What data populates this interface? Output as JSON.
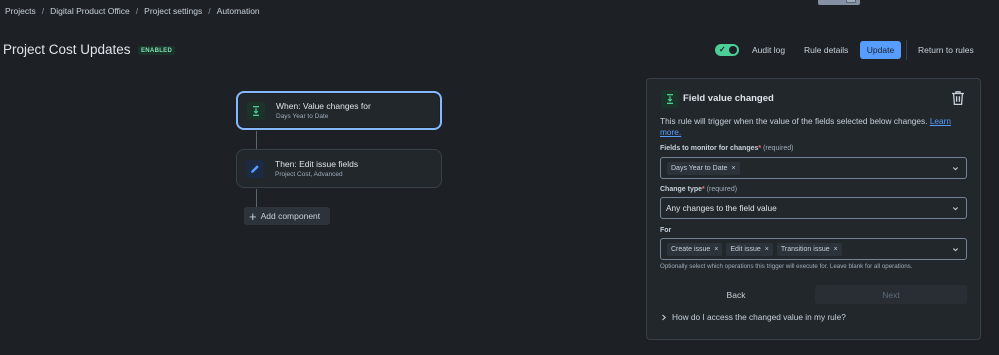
{
  "breadcrumb": {
    "items": [
      "Projects",
      "Digital Product Office",
      "Project settings",
      "Automation"
    ],
    "separator": "/"
  },
  "header": {
    "title": "Project Cost Updates",
    "badge": "ENABLED",
    "toggle_on": true,
    "audit_log": "Audit log",
    "rule_details": "Rule details",
    "update": "Update",
    "return": "Return to rules"
  },
  "flow": {
    "trigger": {
      "title": "When: Value changes for",
      "subtitle": "Days Year to Date",
      "icon": "field-value-icon"
    },
    "action": {
      "title": "Then: Edit issue fields",
      "subtitle": "Project Cost, Advanced",
      "icon": "pencil-icon"
    },
    "add_component": "Add component"
  },
  "panel": {
    "title": "Field value changed",
    "description": "This rule will trigger when the value of the fields selected below changes.",
    "learn_more": "Learn more.",
    "fields_label": "Fields to monitor for changes",
    "required_marker": "*",
    "required_text": "(required)",
    "fields_chips": [
      "Days Year to Date"
    ],
    "change_type_label": "Change type",
    "change_type_value": "Any changes to the field value",
    "for_label": "For",
    "for_chips": [
      "Create issue",
      "Edit issue",
      "Transition issue"
    ],
    "helper": "Optionally select which operations this trigger will execute for. Leave blank for all operations.",
    "back": "Back",
    "next": "Next",
    "faq": "How do I access the changed value in my rule?"
  },
  "colors": {
    "background": "#1d2125",
    "accent": "#579dff",
    "success": "#4bce97",
    "selected_border": "#85b8ff"
  }
}
